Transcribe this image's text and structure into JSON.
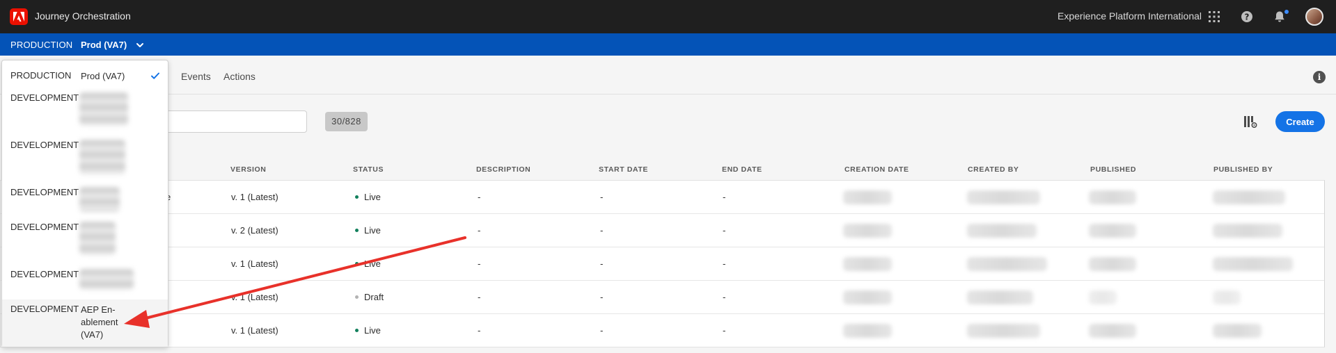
{
  "topbar": {
    "app_title": "Journey Orchestration",
    "org_name": "Experience Platform International",
    "icons": [
      "adobe-logo",
      "apps-grid-icon",
      "help-icon",
      "notifications-bell-icon",
      "user-avatar"
    ]
  },
  "sandbox_bar": {
    "type": "PRODUCTION",
    "name": "Prod (VA7)"
  },
  "tabs": [
    {
      "label": "Events"
    },
    {
      "label": "Actions"
    }
  ],
  "toolbar": {
    "search_value": "",
    "count": "30/828",
    "create_label": "Create"
  },
  "table": {
    "columns": [
      "VERSION",
      "STATUS",
      "DESCRIPTION",
      "START DATE",
      "END DATE",
      "CREATION DATE",
      "CREATED BY",
      "PUBLISHED",
      "PUBLISHED BY"
    ],
    "rows": [
      {
        "name_fragment": "e",
        "version": "v. 1 (Latest)",
        "status": "Live",
        "description": "-",
        "start_date": "-",
        "end_date": "-"
      },
      {
        "name_fragment": "",
        "version": "v. 2 (Latest)",
        "status": "Live",
        "description": "-",
        "start_date": "-",
        "end_date": "-"
      },
      {
        "name_fragment": "",
        "version": "v. 1 (Latest)",
        "status": "Live",
        "description": "-",
        "start_date": "-",
        "end_date": "-"
      },
      {
        "name_fragment": "",
        "version": "v. 1 (Latest)",
        "status": "Draft",
        "description": "-",
        "start_date": "-",
        "end_date": "-"
      },
      {
        "name_fragment": "",
        "version": "v. 1 (Latest)",
        "status": "Live",
        "description": "-",
        "start_date": "-",
        "end_date": "-"
      }
    ],
    "status_colors": {
      "Live": "#12805c",
      "Draft": "#b3b3b3"
    }
  },
  "sandbox_dropdown": {
    "items": [
      {
        "type": "PRODUCTION",
        "name": "Prod (VA7)",
        "selected": true
      },
      {
        "type": "DEVELOPMENT",
        "name": ""
      },
      {
        "type": "DEVELOPMENT",
        "name": ""
      },
      {
        "type": "DEVELOPMENT",
        "name": ""
      },
      {
        "type": "DEVELOPMENT",
        "name": ""
      },
      {
        "type": "DEVELOPMENT",
        "name": ""
      },
      {
        "type": "DEVELOPMENT",
        "name": "AEP En-ablement (VA7)"
      }
    ]
  },
  "colors": {
    "topbar": "#1f1f1f",
    "sandbox_bar": "#0453b7",
    "accent": "#1473e6",
    "adobe_red": "#eb1000",
    "annotation_arrow": "#e8312a"
  }
}
